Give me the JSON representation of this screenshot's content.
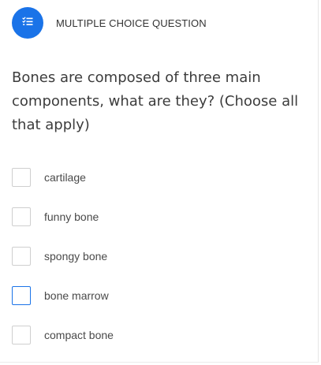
{
  "question_type": {
    "label": "MULTIPLE CHOICE QUESTION",
    "icon": "checklist-icon",
    "badge_color": "#1a73e8"
  },
  "question": {
    "text": "Bones are composed of three main components, what are they?  (Choose all that apply)"
  },
  "options": [
    {
      "label": "cartilage",
      "checked": false
    },
    {
      "label": "funny bone",
      "checked": false
    },
    {
      "label": "spongy bone",
      "checked": false
    },
    {
      "label": "bone marrow",
      "checked": false,
      "focused": true
    },
    {
      "label": "compact bone",
      "checked": false
    }
  ],
  "colors": {
    "accent": "#1a73e8",
    "checkbox_border": "#cfcfcf"
  }
}
